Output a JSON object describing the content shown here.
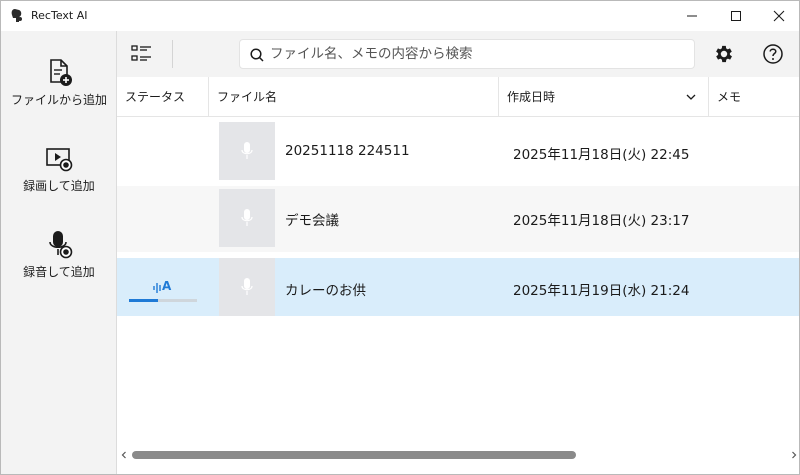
{
  "window": {
    "title": "RecText AI"
  },
  "sidebar": {
    "items": [
      {
        "label": "ファイルから追加",
        "icon": "file-add-icon"
      },
      {
        "label": "録画して追加",
        "icon": "video-record-icon"
      },
      {
        "label": "録音して追加",
        "icon": "mic-record-icon"
      }
    ]
  },
  "toolbar": {
    "search_placeholder": "ファイル名、メモの内容から検索",
    "search_value": ""
  },
  "table": {
    "columns": [
      "ステータス",
      "ファイル名",
      "作成日時",
      "メモ"
    ],
    "sort_column": "作成日時",
    "rows": [
      {
        "status": "",
        "name": "20251118 224511",
        "date": "2025年11月18日(火) 22:45",
        "memo": ""
      },
      {
        "status": "",
        "name": "デモ会議",
        "date": "2025年11月18日(火) 23:17",
        "memo": ""
      },
      {
        "status": "A",
        "name": "カレーのお供",
        "date": "2025年11月19日(水) 21:24",
        "memo": "",
        "progress": 0.42,
        "selected": true
      }
    ]
  },
  "colors": {
    "accent": "#1f7ad6",
    "selected_row": "#d9edfb",
    "sidebar_bg": "#f3f3f3"
  }
}
